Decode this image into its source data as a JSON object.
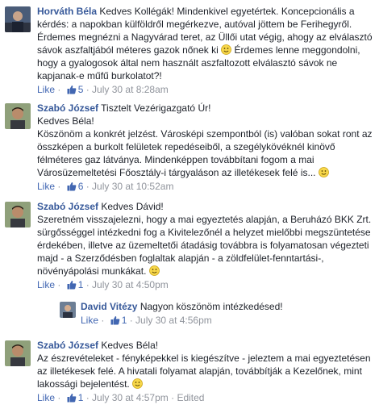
{
  "comments": [
    {
      "author": "Horváth Béla",
      "lines": [
        "Kedves Kollégák! Mindenkivel egyetértek. Koncepcionális a",
        "kérdés: a napokban külföldről megérkezve, autóval jöttem be Ferihegyről.",
        "Érdemes megnézni a Nagyvárad teret, az Üllői utat végig, ahogy az elválasztó",
        "sávok aszfaltjából méteres gazok nőnek ki",
        "Érdemes lenne meggondolni,",
        "hogy a gyalogosok által nem használt aszfaltozott elválasztó sávok ne",
        "kapjanak-e műfű burkolatot?!"
      ],
      "like": "Like",
      "likes": "5",
      "time": "July 30 at 8:28am"
    },
    {
      "author": "Szabó József",
      "lines": [
        "Tisztelt Vezérigazgató Úr!",
        "Kedves Béla!",
        "Köszönöm a konkrét jelzést. Városképi szempontból (is) valóban sokat ront az",
        "összképen a burkolt felületek repedéseiből, a szegélykövéknél kinövő",
        "félméteres gaz látványa. Mindenképpen továbbítani fogom a mai",
        "Városüzemeltetési Főosztály-i tárgyaláson az illetékesek felé is..."
      ],
      "like": "Like",
      "likes": "6",
      "time": "July 30 at 10:52am"
    },
    {
      "author": "Szabó József",
      "lines": [
        "Kedves Dávid!",
        "Szeretném visszajelezni, hogy a mai egyeztetés alapján, a Beruházó BKK Zrt.",
        "sürgősséggel intézkedni fog a Kivitelezőnél a helyzet mielőbbi megszüntetése",
        "érdekében, illetve az üzemeltetői átadásig továbbra is folyamatosan végezteti",
        "majd - a Szerződésben foglaltak alapján - a zöldfelület-fenntartási-,",
        "növényápolási munkákat."
      ],
      "like": "Like",
      "likes": "1",
      "time": "July 30 at 4:50pm"
    },
    {
      "author": "David Vitézy",
      "lines": [
        "Nagyon köszönöm intézkedésed!"
      ],
      "like": "Like",
      "likes": "1",
      "time": "July 30 at 4:56pm"
    },
    {
      "author": "Szabó József",
      "lines": [
        "Kedves Béla!",
        "Az észrevételeket - fényképekkel is kiegészítve - jeleztem a mai egyeztetésen",
        "az illetékesek felé. A hivatali folyamat alapján, továbbítják a Kezelőnek, mint",
        "lakossági bejelentést."
      ],
      "like": "Like",
      "likes": "1",
      "time": "July 30 at 4:57pm",
      "edited": "Edited"
    }
  ],
  "separator": " · ",
  "colors": {
    "link": "#365899",
    "meta": "#90949c",
    "like": "#4267b2",
    "text": "#1d2129"
  }
}
